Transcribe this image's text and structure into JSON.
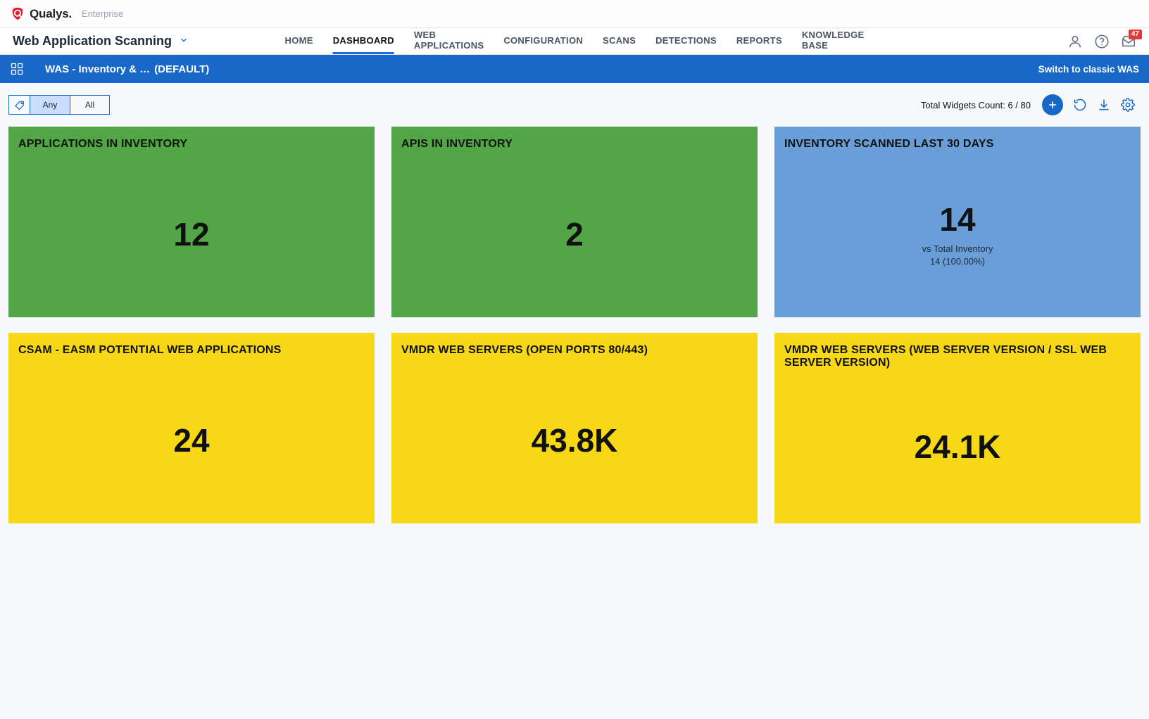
{
  "brand": {
    "name": "Qualys",
    "tier": "Enterprise"
  },
  "app": {
    "name": "Web Application Scanning"
  },
  "nav": {
    "items": [
      {
        "label": "HOME",
        "active": false
      },
      {
        "label": "DASHBOARD",
        "active": true
      },
      {
        "label": "WEB APPLICATIONS",
        "active": false
      },
      {
        "label": "CONFIGURATION",
        "active": false
      },
      {
        "label": "SCANS",
        "active": false
      },
      {
        "label": "DETECTIONS",
        "active": false
      },
      {
        "label": "REPORTS",
        "active": false
      },
      {
        "label": "KNOWLEDGE BASE",
        "active": false
      }
    ]
  },
  "notifications": {
    "count": "47"
  },
  "dashboard_bar": {
    "name": "WAS - Inventory & …",
    "default_label": "(DEFAULT)",
    "switch_link": "Switch to classic WAS"
  },
  "toolbar": {
    "segments": {
      "any": "Any",
      "all": "All",
      "active": "any"
    },
    "widget_count_label": "Total Widgets Count: 6 / 80"
  },
  "widgets": [
    {
      "title": "APPLICATIONS IN INVENTORY",
      "value": "12",
      "color": "green"
    },
    {
      "title": "APIS IN INVENTORY",
      "value": "2",
      "color": "green"
    },
    {
      "title": "INVENTORY SCANNED LAST 30 DAYS",
      "value": "14",
      "color": "blue",
      "sub1": "vs Total Inventory",
      "sub2": "14 (100.00%)"
    },
    {
      "title": "CSAM - EASM POTENTIAL WEB APPLICATIONS",
      "value": "24",
      "color": "yellow"
    },
    {
      "title": "VMDR WEB SERVERS (OPEN PORTS 80/443)",
      "value": "43.8K",
      "color": "yellow"
    },
    {
      "title": "VMDR WEB SERVERS (WEB SERVER VERSION / SSL WEB SERVER VERSION)",
      "value": "24.1K",
      "color": "yellow"
    }
  ],
  "colors": {
    "green": "#52a646",
    "blue": "#6a9ed9",
    "yellow": "#f7d817",
    "brand_blue": "#1768c9"
  }
}
